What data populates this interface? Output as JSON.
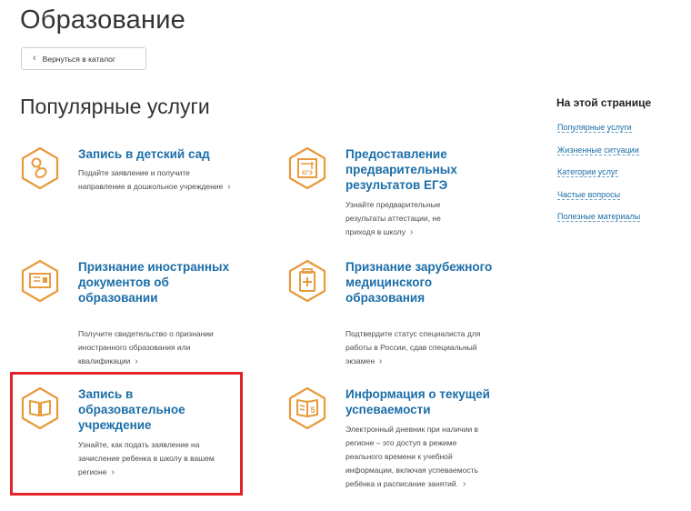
{
  "header": {
    "title": "Образование",
    "back_label": "Вернуться в каталог"
  },
  "section": {
    "title": "Популярные услуги"
  },
  "accent_color": "#e89a3c",
  "link_color": "#1b6ea8",
  "highlight_color": "#e3222a",
  "services": [
    {
      "title": "Запись в детский сад",
      "description": "Подайте заявление и получите направление в дошкольное учреждение",
      "more": "›",
      "icon": "pacifier-icon"
    },
    {
      "title": "Предоставление предварительных результатов ЕГЭ",
      "description": "Узнайте предварительные результаты аттестации, не приходя в школу",
      "more": "›",
      "icon": "exam-certificate-icon"
    },
    {
      "title": "Признание иностранных документов об образовании",
      "description": "Получите свидетельство о признании иностранного образования или квалификации",
      "more": "›",
      "icon": "diploma-icon"
    },
    {
      "title": "Признание зарубежного медицинского образования",
      "description": "Подтвердите статус специалиста для работы в России, сдав специальный экзамен",
      "more": "›",
      "icon": "medical-document-icon"
    },
    {
      "title": "Запись в образовательное учреждение",
      "description": "Узнайте, как подать заявление на зачисление ребенка в школу в вашем регионе",
      "more": "›",
      "icon": "open-book-icon"
    },
    {
      "title": "Информация о текущей успеваемости",
      "description": "Электронный дневник при наличии в регионе – это доступ в режиме реального времени к учебной информации, включая успеваемость ребёнка и расписание занятий.",
      "more": "›",
      "icon": "gradebook-icon"
    }
  ],
  "toc": {
    "title": "На этой странице",
    "items": [
      "Популярные услуги",
      "Жизненные ситуации",
      "Категории услуг",
      "Частые вопросы",
      "Полезные материалы"
    ]
  }
}
